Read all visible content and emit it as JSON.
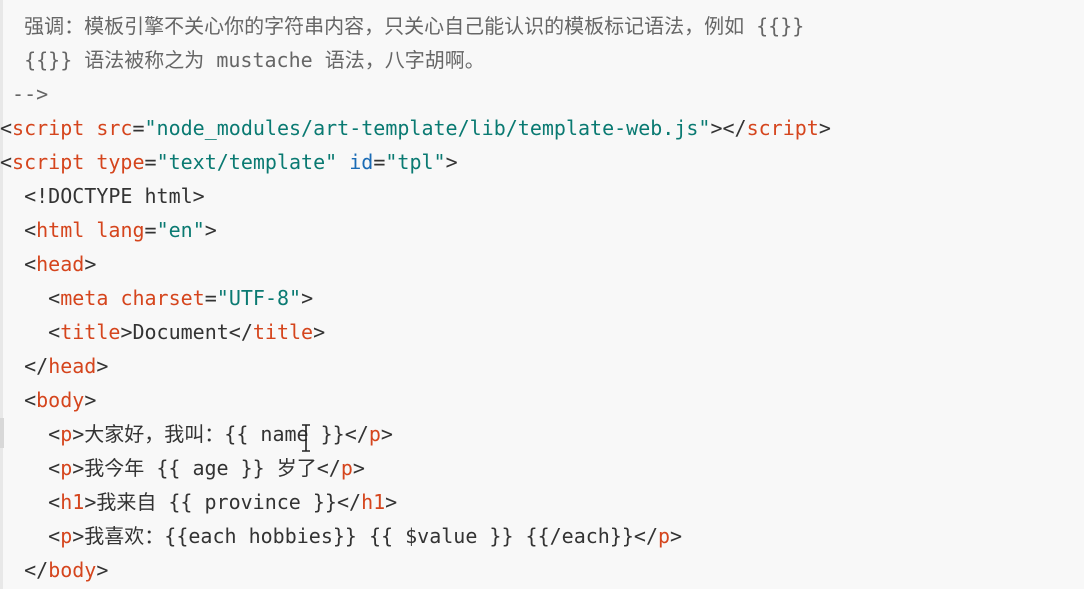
{
  "editor": {
    "lines": [
      {
        "indent": "  ",
        "parts": [
          {
            "t": "强调：模板引擎不关心你的字符串内容，只关心自己能认识的模板标记语法，例如 {{}}",
            "c": "cmt"
          }
        ]
      },
      {
        "indent": "  ",
        "parts": [
          {
            "t": "{{}} 语法被称之为 mustache 语法，八字胡啊。",
            "c": "cmt"
          }
        ]
      },
      {
        "indent": " ",
        "parts": [
          {
            "t": "-->",
            "c": "cmt"
          }
        ]
      },
      {
        "indent": "",
        "parts": [
          {
            "t": "<",
            "c": "txt"
          },
          {
            "t": "script",
            "c": "tag"
          },
          {
            "t": " ",
            "c": "txt"
          },
          {
            "t": "src",
            "c": "tag"
          },
          {
            "t": "=",
            "c": "txt"
          },
          {
            "t": "\"node_modules/art-template/lib/template-web.js\"",
            "c": "str"
          },
          {
            "t": "></",
            "c": "txt"
          },
          {
            "t": "script",
            "c": "tag"
          },
          {
            "t": ">",
            "c": "txt"
          }
        ]
      },
      {
        "indent": "",
        "parts": [
          {
            "t": "<",
            "c": "txt"
          },
          {
            "t": "script",
            "c": "tag"
          },
          {
            "t": " ",
            "c": "txt"
          },
          {
            "t": "type",
            "c": "tag"
          },
          {
            "t": "=",
            "c": "txt"
          },
          {
            "t": "\"text/template\"",
            "c": "str"
          },
          {
            "t": " ",
            "c": "txt"
          },
          {
            "t": "id",
            "c": "attr-blue"
          },
          {
            "t": "=",
            "c": "txt"
          },
          {
            "t": "\"tpl\"",
            "c": "str"
          },
          {
            "t": ">",
            "c": "txt"
          }
        ]
      },
      {
        "indent": "  ",
        "parts": [
          {
            "t": "<!DOCTYPE html>",
            "c": "txt"
          }
        ]
      },
      {
        "indent": "  ",
        "parts": [
          {
            "t": "<",
            "c": "txt"
          },
          {
            "t": "html",
            "c": "tag"
          },
          {
            "t": " ",
            "c": "txt"
          },
          {
            "t": "lang",
            "c": "tag"
          },
          {
            "t": "=",
            "c": "txt"
          },
          {
            "t": "\"en\"",
            "c": "str"
          },
          {
            "t": ">",
            "c": "txt"
          }
        ]
      },
      {
        "indent": "  ",
        "parts": [
          {
            "t": "<",
            "c": "txt"
          },
          {
            "t": "head",
            "c": "tag"
          },
          {
            "t": ">",
            "c": "txt"
          }
        ]
      },
      {
        "indent": "    ",
        "parts": [
          {
            "t": "<",
            "c": "txt"
          },
          {
            "t": "meta",
            "c": "tag"
          },
          {
            "t": " ",
            "c": "txt"
          },
          {
            "t": "charset",
            "c": "tag"
          },
          {
            "t": "=",
            "c": "txt"
          },
          {
            "t": "\"UTF-8\"",
            "c": "str"
          },
          {
            "t": ">",
            "c": "txt"
          }
        ]
      },
      {
        "indent": "    ",
        "parts": [
          {
            "t": "<",
            "c": "txt"
          },
          {
            "t": "title",
            "c": "tag"
          },
          {
            "t": ">Document</",
            "c": "txt"
          },
          {
            "t": "title",
            "c": "tag"
          },
          {
            "t": ">",
            "c": "txt"
          }
        ]
      },
      {
        "indent": "  ",
        "parts": [
          {
            "t": "</",
            "c": "txt"
          },
          {
            "t": "head",
            "c": "tag"
          },
          {
            "t": ">",
            "c": "txt"
          }
        ]
      },
      {
        "indent": "  ",
        "parts": [
          {
            "t": "<",
            "c": "txt"
          },
          {
            "t": "body",
            "c": "tag"
          },
          {
            "t": ">",
            "c": "txt"
          }
        ]
      },
      {
        "indent": "    ",
        "parts": [
          {
            "t": "<",
            "c": "txt"
          },
          {
            "t": "p",
            "c": "tag"
          },
          {
            "t": ">大家好，我叫：{{ name }}</",
            "c": "txt"
          },
          {
            "t": "p",
            "c": "tag"
          },
          {
            "t": ">",
            "c": "txt"
          }
        ]
      },
      {
        "indent": "    ",
        "parts": [
          {
            "t": "<",
            "c": "txt"
          },
          {
            "t": "p",
            "c": "tag"
          },
          {
            "t": ">我今年 {{ age }} 岁了</",
            "c": "txt"
          },
          {
            "t": "p",
            "c": "tag"
          },
          {
            "t": ">",
            "c": "txt"
          }
        ]
      },
      {
        "indent": "    ",
        "parts": [
          {
            "t": "<",
            "c": "txt"
          },
          {
            "t": "h1",
            "c": "tag"
          },
          {
            "t": ">我来自 {{ province }}</",
            "c": "txt"
          },
          {
            "t": "h1",
            "c": "tag"
          },
          {
            "t": ">",
            "c": "txt"
          }
        ]
      },
      {
        "indent": "    ",
        "parts": [
          {
            "t": "<",
            "c": "txt"
          },
          {
            "t": "p",
            "c": "tag"
          },
          {
            "t": ">我喜欢：{{each hobbies}} {{ $value }} {{/each}}</",
            "c": "txt"
          },
          {
            "t": "p",
            "c": "tag"
          },
          {
            "t": ">",
            "c": "txt"
          }
        ]
      },
      {
        "indent": "  ",
        "parts": [
          {
            "t": "</",
            "c": "txt"
          },
          {
            "t": "body",
            "c": "tag"
          },
          {
            "t": ">",
            "c": "txt"
          }
        ]
      }
    ]
  },
  "colors": {
    "tag": "#d5451d",
    "string": "#0a7a72",
    "attr_blue": "#1a6bb5",
    "text": "#333333",
    "comment": "#666666",
    "background": "#f8f8f8"
  }
}
